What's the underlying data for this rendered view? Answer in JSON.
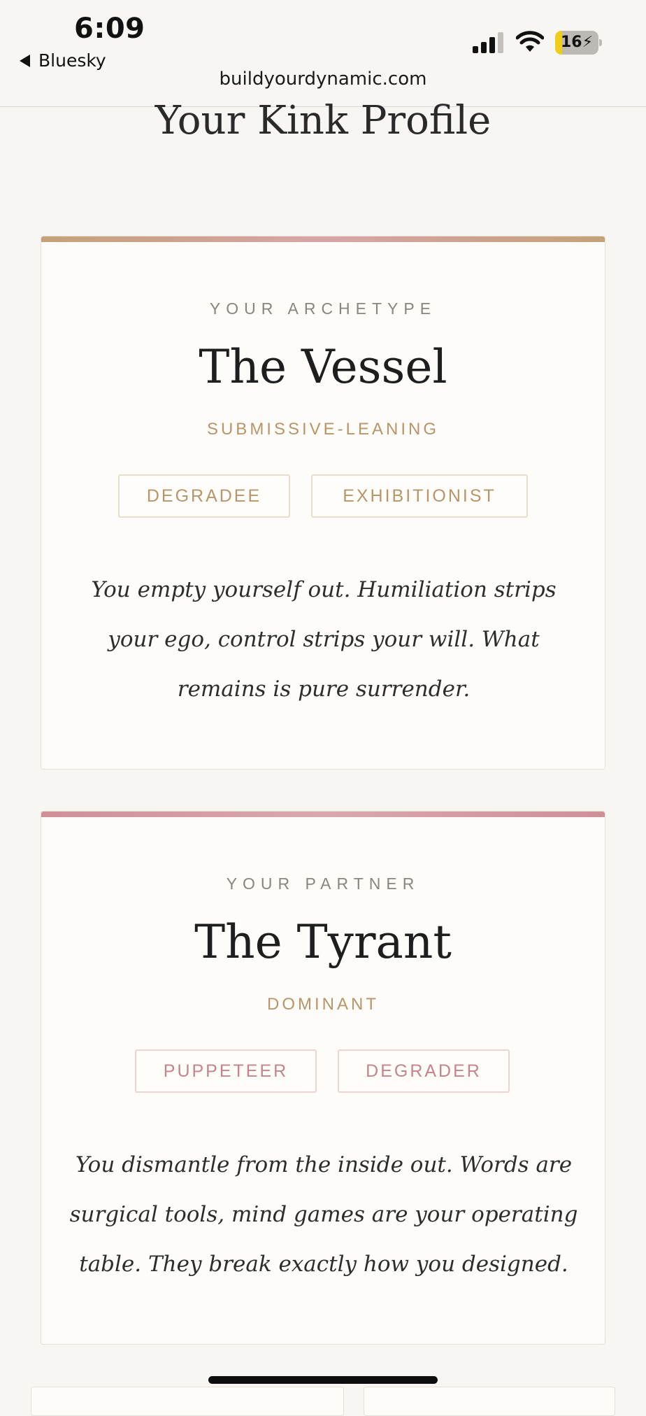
{
  "status_bar": {
    "time": "6:09",
    "back_label": "Bluesky",
    "battery_level": "16",
    "battery_fraction": 0.16,
    "battery_color": "#f2cc1a"
  },
  "browser": {
    "url": "buildyourdynamic.com"
  },
  "page": {
    "title": "Your Kink Profile"
  },
  "archetype_card": {
    "eyebrow": "YOUR ARCHETYPE",
    "name": "The Vessel",
    "leaning": "SUBMISSIVE-LEANING",
    "tags": [
      "DEGRADEE",
      "EXHIBITIONIST"
    ],
    "description": "You empty yourself out. Humiliation strips your ego, control strips your will. What remains is pure surrender.",
    "accent_color": "#c4a178"
  },
  "partner_card": {
    "eyebrow": "YOUR PARTNER",
    "name": "The Tyrant",
    "leaning": "DOMINANT",
    "tags": [
      "PUPPETEER",
      "DEGRADER"
    ],
    "description": "You dismantle from the inside out. Words are surgical tools, mind games are your operating table. They break exactly how you designed.",
    "accent_color": "#cf8f98"
  },
  "icons": {
    "back": "back-arrow-icon",
    "signal": "cellular-signal-icon",
    "wifi": "wifi-icon",
    "battery": "battery-charging-icon"
  }
}
